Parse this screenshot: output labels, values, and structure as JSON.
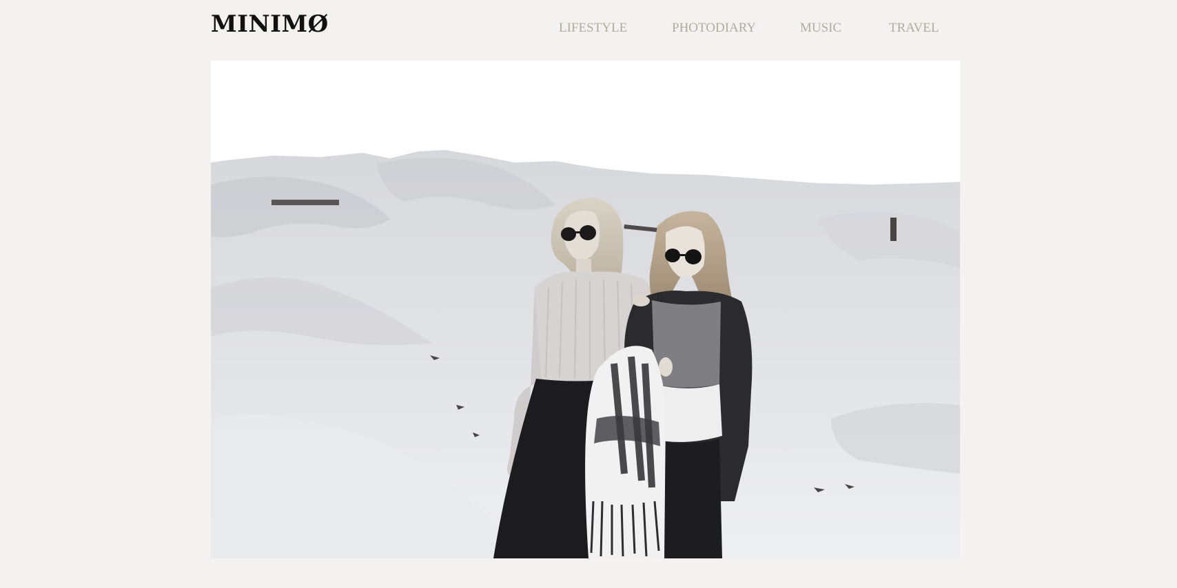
{
  "site": {
    "logo": "MINIMØ"
  },
  "nav": {
    "items": [
      {
        "label": "LIFESTYLE"
      },
      {
        "label": "PHOTODIARY"
      },
      {
        "label": "MUSIC"
      },
      {
        "label": "TRAVEL"
      }
    ]
  },
  "hero": {
    "image": "black-and-white photo of two women in sunglasses standing on sand dunes, one holding a fringed blanket"
  },
  "colors": {
    "background": "#f3f2f0",
    "logo": "#111111",
    "nav_text": "#b3ab9c"
  }
}
